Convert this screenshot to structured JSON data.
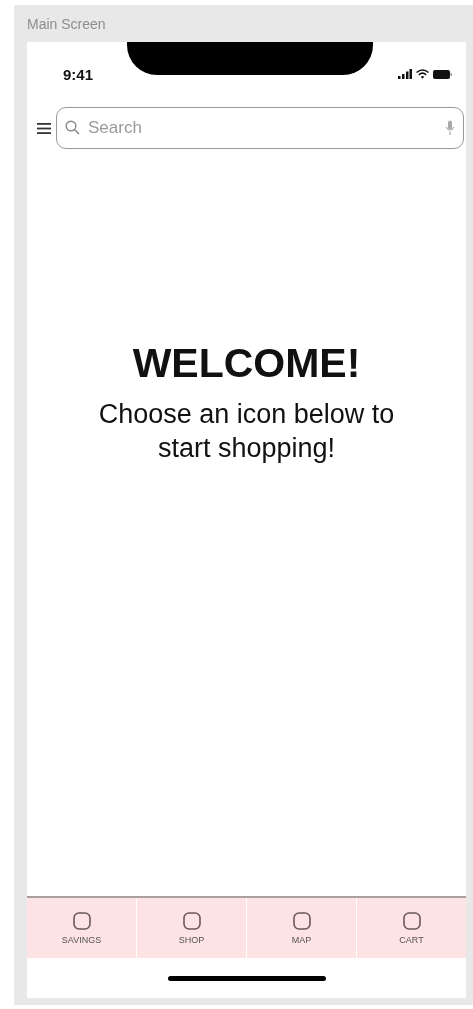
{
  "artboard": {
    "title": "Main Screen"
  },
  "status_bar": {
    "time": "9:41"
  },
  "search": {
    "placeholder": "Search"
  },
  "welcome": {
    "heading": "WELCOME!",
    "message": "Choose an icon below to start shopping!"
  },
  "tab_bar": [
    {
      "label": "SAVINGS"
    },
    {
      "label": "SHOP"
    },
    {
      "label": "MAP"
    },
    {
      "label": "CART"
    }
  ]
}
